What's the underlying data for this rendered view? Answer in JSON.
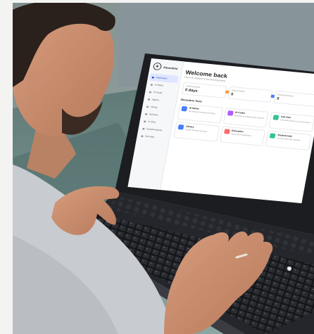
{
  "app": {
    "brand": "Alexandria",
    "title": "Welcome back",
    "subtitle": "Here's an overview of your learning journey"
  },
  "nav": [
    {
      "label": "Dashboard",
      "active": true
    },
    {
      "label": "AI Writer"
    },
    {
      "label": "AI Coder"
    },
    {
      "label": "Agents"
    },
    {
      "label": "Library"
    },
    {
      "label": "Ask Alex"
    },
    {
      "label": "AI Chat"
    },
    {
      "label": "Customizations"
    },
    {
      "label": "Get Help"
    }
  ],
  "stats": [
    {
      "label": "Learning Streak",
      "value": "0 days",
      "color": "#ff9a3c"
    },
    {
      "label": "Notes Created",
      "value": "0",
      "color": "#4a7dff"
    },
    {
      "label": "Saved Resources",
      "value": "0",
      "color": "#34c38f"
    },
    {
      "label": "",
      "value": "",
      "color": "#ffb84d"
    }
  ],
  "tools_heading": "Alexandria Tools",
  "tools": [
    {
      "name": "AI Writer",
      "desc": "Get help with writing and editing",
      "color": "#4a7dff"
    },
    {
      "name": "AI Coder",
      "desc": "Generate and debug code solutions",
      "color": "#b05cff"
    },
    {
      "name": "Ask Alex",
      "desc": "Get quick answers to your questions",
      "color": "#34c38f"
    },
    {
      "name": "Library",
      "desc": "Access learning resources",
      "color": "#4a7dff"
    },
    {
      "name": "Education",
      "desc": "Study with AI assistance",
      "color": "#ff6b6b"
    },
    {
      "name": "Student Hub",
      "desc": "Connect with other students",
      "color": "#34c38f"
    }
  ],
  "colors": {
    "wall": "#8a9a96",
    "couch": "#6f8a86",
    "shirt": "#c9ccd1",
    "skin": "#c98d6f",
    "hair": "#2b211c",
    "laptop": "#1e2024",
    "keyboard": "#17181b"
  }
}
